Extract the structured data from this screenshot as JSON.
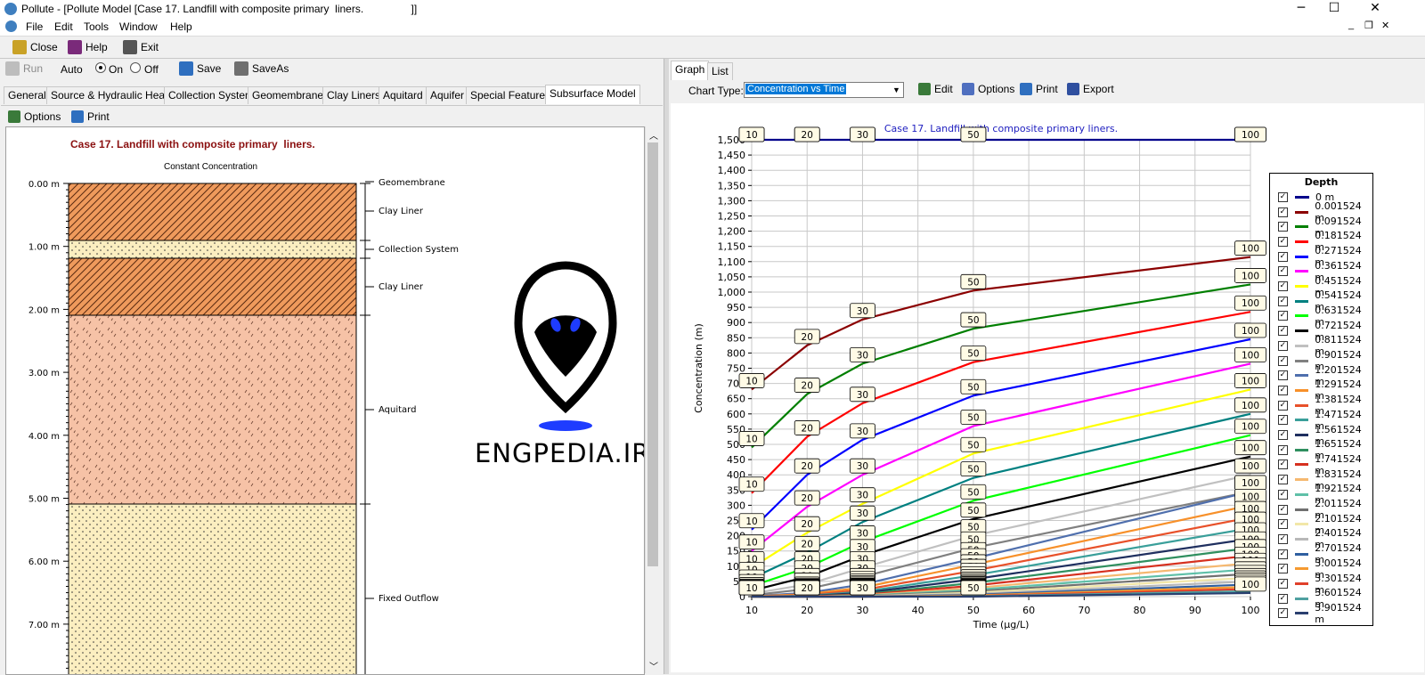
{
  "window": {
    "title": "Pollute - [Pollute Model [Case 17. Landfill with composite primary  liners.                ]]",
    "minimize": "─",
    "maximize": "☐",
    "close": "✕"
  },
  "menu": [
    "File",
    "Edit",
    "Tools",
    "Window",
    "Help"
  ],
  "toolbar": {
    "close": "Close",
    "help": "Help",
    "exit": "Exit"
  },
  "left": {
    "run": "Run",
    "auto": "Auto",
    "on": "On",
    "off": "Off",
    "save": "Save",
    "saveas": "SaveAs",
    "tabs": [
      "General",
      "Source & Hydraulic Heads",
      "Collection System",
      "Geomembranes",
      "Clay Liners",
      "Aquitard",
      "Aquifer",
      "Special Features",
      "Subsurface Model"
    ],
    "active_tab": "Subsurface Model",
    "options": "Options",
    "print": "Print",
    "model_title": "Case 17. Landfill with composite primary  liners.",
    "source_label": "Constant Concentration",
    "depth_ticks": [
      "0.00 m",
      "1.00 m",
      "2.00 m",
      "3.00 m",
      "4.00 m",
      "5.00 m",
      "6.00 m",
      "7.00 m"
    ],
    "layer_labels": [
      "Geomembrane",
      "Clay Liner",
      "Collection System",
      "Clay Liner",
      "Aquitard",
      "Fixed Outflow"
    ],
    "watermark": "ENGPEDIA.IR"
  },
  "right": {
    "tabs": [
      "Graph",
      "List"
    ],
    "active_tab": "Graph",
    "chart_type_label": "Chart Type:",
    "chart_type_value": "Concentration vs Time",
    "edit": "Edit",
    "options": "Options",
    "print": "Print",
    "export": "Export"
  },
  "chart_data": {
    "type": "line",
    "title": "Case 17. Landfill with composite primary  liners.",
    "xlabel": "Time (µg/L)",
    "ylabel": "Concentration (m)",
    "xlim": [
      10,
      100
    ],
    "ylim": [
      0,
      1500
    ],
    "xticks": [
      10,
      20,
      30,
      40,
      50,
      60,
      70,
      80,
      90,
      100
    ],
    "yticks": [
      0,
      50,
      100,
      150,
      200,
      250,
      300,
      350,
      400,
      450,
      500,
      550,
      600,
      650,
      700,
      750,
      800,
      850,
      900,
      950,
      1000,
      1050,
      1100,
      1150,
      1200,
      1250,
      1300,
      1350,
      1400,
      1450,
      1500
    ],
    "ytick_labels": [
      "0",
      "50",
      "100",
      "150",
      "200",
      "250",
      "300",
      "350",
      "400",
      "450",
      "500",
      "550",
      "600",
      "650",
      "700",
      "750",
      "800",
      "850",
      "900",
      "950",
      "1,000",
      "1,050",
      "1,100",
      "1,150",
      "1,200",
      "1,250",
      "1,300",
      "1,350",
      "1,400",
      "1,450",
      "1,500"
    ],
    "x": [
      10,
      20,
      30,
      50,
      100
    ],
    "grid": true,
    "legend_title": "Depth",
    "legend_position": "right",
    "series": [
      {
        "name": "0 m",
        "color": "#00008b",
        "values": [
          1500,
          1500,
          1500,
          1500,
          1500
        ]
      },
      {
        "name": "0.001524 m",
        "color": "#8b0000",
        "values": [
          680,
          825,
          910,
          1005,
          1115
        ]
      },
      {
        "name": "0.091524 m",
        "color": "#007f00",
        "values": [
          490,
          665,
          765,
          880,
          1025
        ]
      },
      {
        "name": "0.181524 m",
        "color": "#ff0000",
        "values": [
          340,
          525,
          635,
          770,
          935
        ]
      },
      {
        "name": "0.271524 m",
        "color": "#0000ff",
        "values": [
          220,
          400,
          515,
          660,
          845
        ]
      },
      {
        "name": "0.361524 m",
        "color": "#ff00ff",
        "values": [
          150,
          295,
          400,
          560,
          765
        ]
      },
      {
        "name": "0.451524 m",
        "color": "#ffff00",
        "values": [
          95,
          210,
          305,
          470,
          680
        ]
      },
      {
        "name": "0.541524 m",
        "color": "#008080",
        "values": [
          60,
          145,
          245,
          390,
          600
        ]
      },
      {
        "name": "0.631524 m",
        "color": "#00ff00",
        "values": [
          35,
          95,
          180,
          315,
          530
        ]
      },
      {
        "name": "0.721524 m",
        "color": "#000000",
        "values": [
          20,
          65,
          135,
          255,
          460
        ]
      },
      {
        "name": "0.811524 m",
        "color": "#c0c0c0",
        "values": [
          10,
          40,
          95,
          200,
          400
        ]
      },
      {
        "name": "0.901524 m",
        "color": "#808080",
        "values": [
          5,
          25,
          65,
          160,
          345
        ]
      },
      {
        "name": "1.201524 m",
        "color": "#4f6fad",
        "values": [
          2,
          12,
          40,
          125,
          345
        ]
      },
      {
        "name": "1.291524 m",
        "color": "#f7902a",
        "values": [
          1,
          8,
          30,
          105,
          300
        ]
      },
      {
        "name": "1.381524 m",
        "color": "#e8512a",
        "values": [
          0,
          5,
          22,
          85,
          260
        ]
      },
      {
        "name": "1.471524 m",
        "color": "#3a9f9a",
        "values": [
          0,
          3,
          16,
          70,
          225
        ]
      },
      {
        "name": "1.561524 m",
        "color": "#1f2f5f",
        "values": [
          0,
          2,
          12,
          57,
          190
        ]
      },
      {
        "name": "1.651524 m",
        "color": "#2f8f5f",
        "values": [
          0,
          1,
          8,
          45,
          160
        ]
      },
      {
        "name": "1.741524 m",
        "color": "#d6301f",
        "values": [
          0,
          1,
          6,
          36,
          135
        ]
      },
      {
        "name": "1.831524 m",
        "color": "#f5b870",
        "values": [
          0,
          0,
          4,
          28,
          110
        ]
      },
      {
        "name": "1.921524 m",
        "color": "#5fc0a8",
        "values": [
          0,
          0,
          3,
          22,
          90
        ]
      },
      {
        "name": "2.011524 m",
        "color": "#707070",
        "values": [
          0,
          0,
          2,
          17,
          75
        ]
      },
      {
        "name": "2.101524 m",
        "color": "#f2e7a8",
        "values": [
          0,
          0,
          1,
          13,
          62
        ]
      },
      {
        "name": "2.401524 m",
        "color": "#b8b8b8",
        "values": [
          0,
          0,
          1,
          9,
          50
        ]
      },
      {
        "name": "2.701524 m",
        "color": "#2f5fa0",
        "values": [
          0,
          0,
          0,
          6,
          40
        ]
      },
      {
        "name": "3.001524 m",
        "color": "#f59a30",
        "values": [
          0,
          0,
          0,
          4,
          32
        ]
      },
      {
        "name": "3.301524 m",
        "color": "#e0402a",
        "values": [
          0,
          0,
          0,
          2,
          25
        ]
      },
      {
        "name": "3.601524 m",
        "color": "#4fa0a0",
        "values": [
          0,
          0,
          0,
          1,
          18
        ]
      },
      {
        "name": "3.901524 m",
        "color": "#2a3f6f",
        "values": [
          0,
          0,
          0,
          0,
          12
        ]
      }
    ]
  }
}
